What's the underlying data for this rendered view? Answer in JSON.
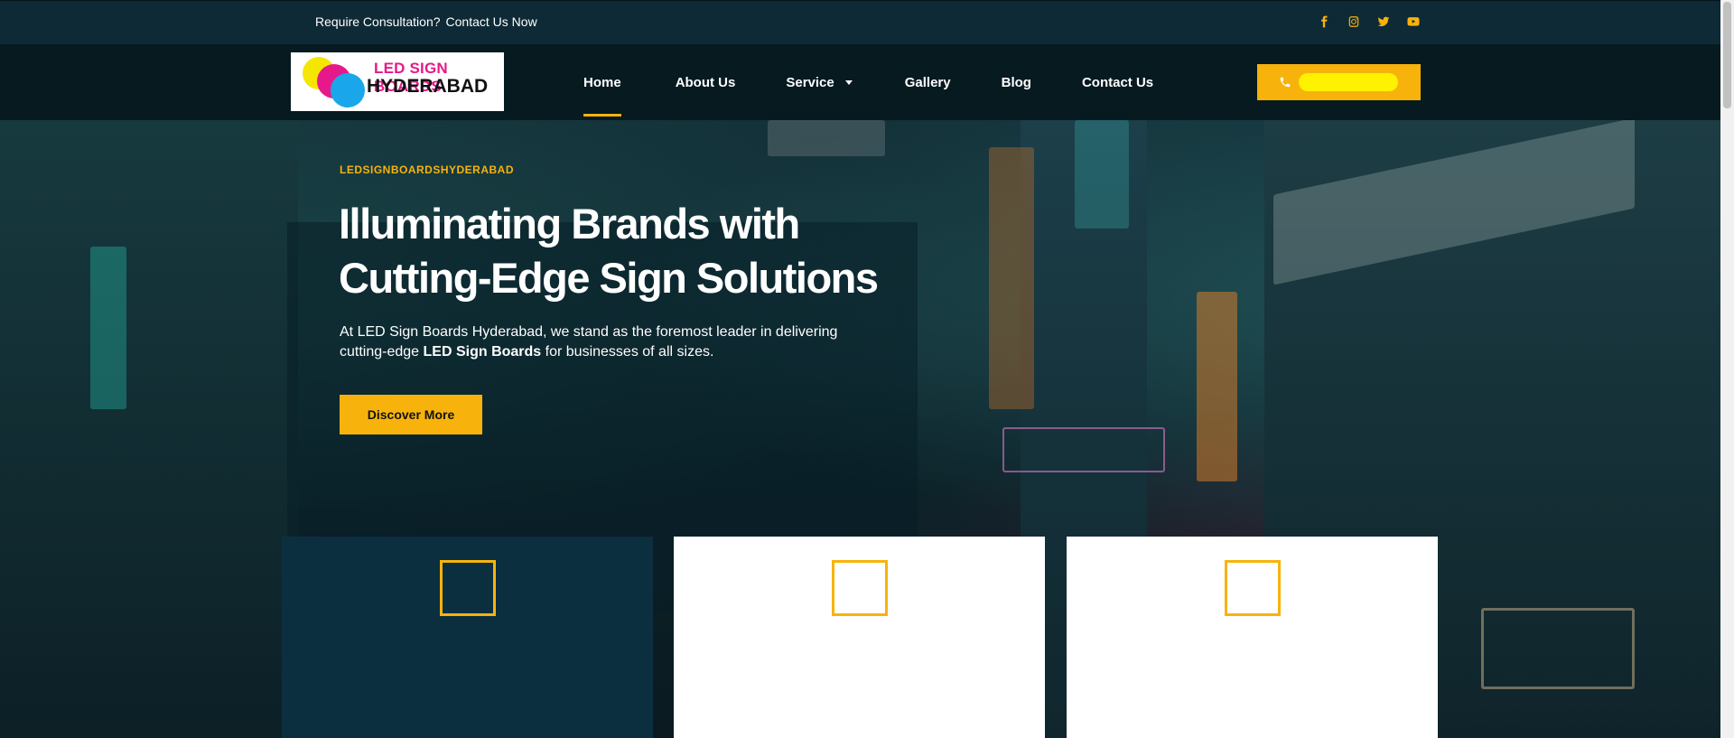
{
  "topbar": {
    "consult_label": "Require Consultation?",
    "contact_link": "Contact Us Now",
    "socials": [
      "facebook-icon",
      "instagram-icon",
      "twitter-icon",
      "youtube-icon"
    ]
  },
  "nav": {
    "logo_line1": "LED SIGN BOARDS",
    "logo_line2": "HYDERABAD",
    "items": [
      {
        "label": "Home",
        "active": true
      },
      {
        "label": "About Us"
      },
      {
        "label": "Service",
        "has_dropdown": true
      },
      {
        "label": "Gallery"
      },
      {
        "label": "Blog"
      },
      {
        "label": "Contact Us"
      }
    ]
  },
  "hero": {
    "eyebrow": "LEDSIGNBOARDSHYDERABAD",
    "title_line1": "Illuminating Brands with",
    "title_line2": "Cutting-Edge Sign Solutions",
    "desc_before": "At LED Sign Boards Hyderabad, we stand as the foremost leader in delivering cutting-edge",
    "desc_bold": "LED Sign Boards",
    "desc_after": "for businesses of all sizes.",
    "cta": "Discover More"
  },
  "colors": {
    "accent": "#f7b30c",
    "topbar_bg": "#0e2a36",
    "nav_bg": "#061a20",
    "card_dark": "#0c2f40"
  }
}
